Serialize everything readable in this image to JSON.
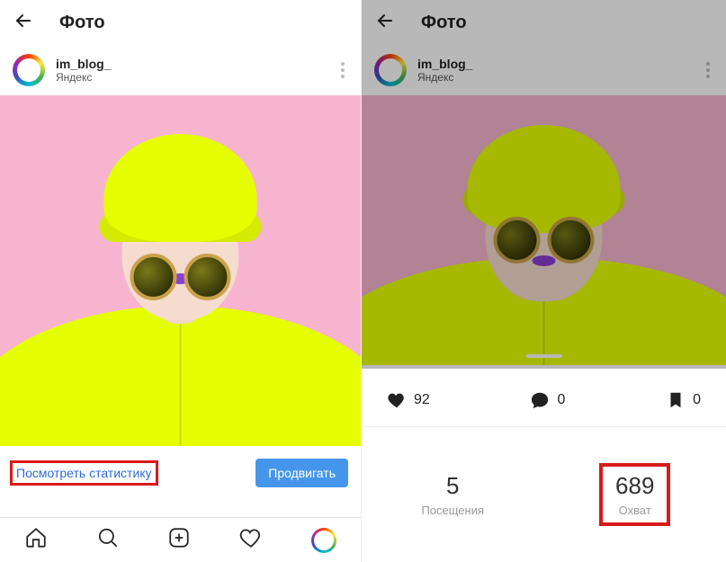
{
  "left": {
    "header_title": "Фото",
    "username": "im_blog_",
    "location": "Яндекс",
    "stats_link": "Посмотреть статистику",
    "promote": "Продвигать"
  },
  "right": {
    "header_title": "Фото",
    "username": "im_blog_",
    "location": "Яндекс",
    "likes": "92",
    "comments": "0",
    "saves": "0",
    "visits_count": "5",
    "visits_label": "Посещения",
    "reach_count": "689",
    "reach_label": "Охват"
  }
}
